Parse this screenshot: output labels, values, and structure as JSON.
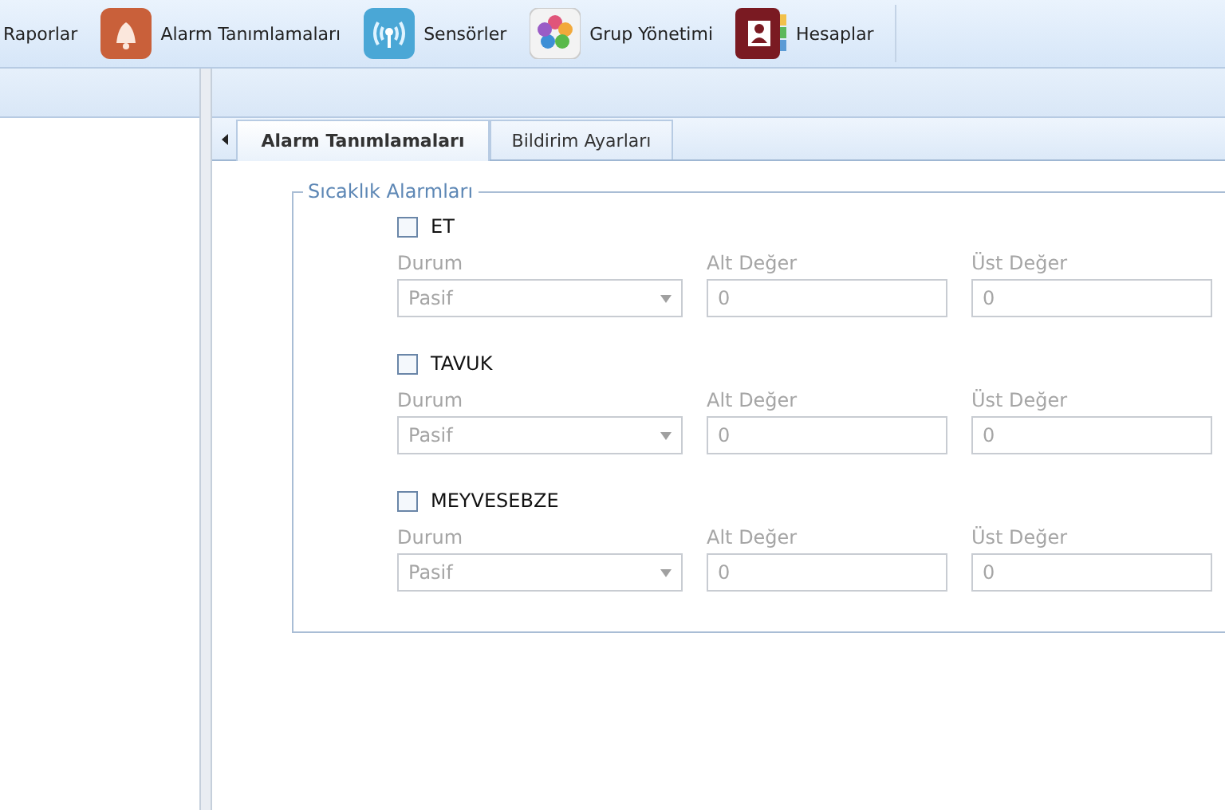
{
  "toolbar": {
    "items": [
      {
        "label": "Raporlar"
      },
      {
        "label": "Alarm Tanımlamaları"
      },
      {
        "label": "Sensörler"
      },
      {
        "label": "Grup Yönetimi"
      },
      {
        "label": "Hesaplar"
      }
    ]
  },
  "tabs": [
    {
      "label": "Alarm Tanımlamaları",
      "selected": true
    },
    {
      "label": "Bildirim Ayarları",
      "selected": false
    }
  ],
  "group": {
    "legend": "Sıcaklık Alarmları",
    "alarms": [
      {
        "name": "ET",
        "checked": false,
        "disabled": true,
        "status_label": "Durum",
        "status": "Pasif",
        "low_label": "Alt Değer",
        "low": "0",
        "high_label": "Üst Değer",
        "high": "0"
      },
      {
        "name": "TAVUK",
        "checked": false,
        "disabled": true,
        "status_label": "Durum",
        "status": "Pasif",
        "low_label": "Alt Değer",
        "low": "0",
        "high_label": "Üst Değer",
        "high": "0"
      },
      {
        "name": "MEYVESEBZE",
        "checked": false,
        "disabled": true,
        "status_label": "Durum",
        "status": "Pasif",
        "low_label": "Alt Değer",
        "low": "0",
        "high_label": "Üst Değer",
        "high": "0"
      }
    ]
  }
}
